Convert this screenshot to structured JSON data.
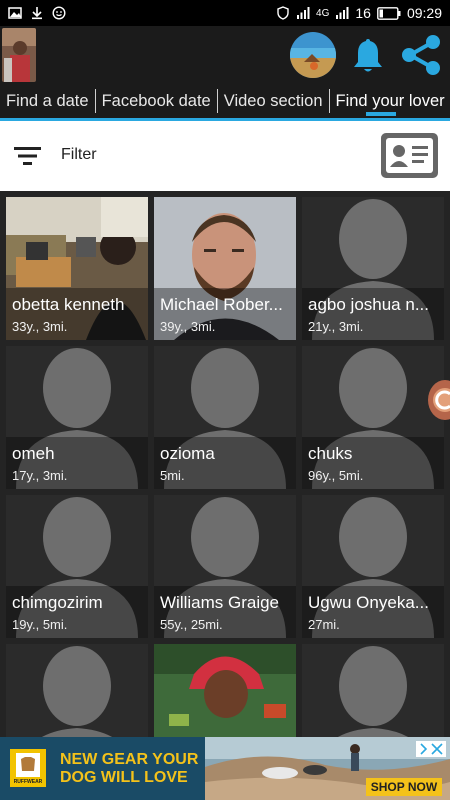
{
  "status_bar": {
    "network": "4G",
    "battery": "16",
    "time": "09:29"
  },
  "header": {
    "icons": [
      "bell-icon",
      "share-icon"
    ]
  },
  "tabs": [
    {
      "label": "Find a date",
      "active": false
    },
    {
      "label": "Facebook date",
      "active": false
    },
    {
      "label": "Video section",
      "active": false
    },
    {
      "label": "Find your lover",
      "active": true
    }
  ],
  "filter": {
    "label": "Filter"
  },
  "profiles": [
    {
      "name": "obetta kenneth",
      "meta": "33y., 3mi.",
      "photo": "office"
    },
    {
      "name": "Michael Rober...",
      "meta": "39y., 3mi.",
      "photo": "portrait"
    },
    {
      "name": "agbo joshua n...",
      "meta": "21y., 3mi.",
      "photo": "placeholder"
    },
    {
      "name": "omeh",
      "meta": "17y., 3mi.",
      "photo": "placeholder"
    },
    {
      "name": "ozioma",
      "meta": "5mi.",
      "photo": "placeholder"
    },
    {
      "name": "chuks",
      "meta": "96y., 5mi.",
      "photo": "placeholder"
    },
    {
      "name": "chimgozirim",
      "meta": "19y., 5mi.",
      "photo": "placeholder"
    },
    {
      "name": "Williams Graige",
      "meta": "55y., 25mi.",
      "photo": "placeholder"
    },
    {
      "name": "Ugwu Onyeka...",
      "meta": "27mi.",
      "photo": "placeholder"
    },
    {
      "name": "",
      "meta": "",
      "photo": "placeholder"
    },
    {
      "name": "",
      "meta": "",
      "photo": "colorful"
    },
    {
      "name": "",
      "meta": "",
      "photo": "placeholder"
    }
  ],
  "ad": {
    "headline_1": "NEW GEAR YOUR",
    "headline_2": "DOG WILL LOVE",
    "cta": "SHOP NOW",
    "brand": "RUFFWEAR"
  }
}
